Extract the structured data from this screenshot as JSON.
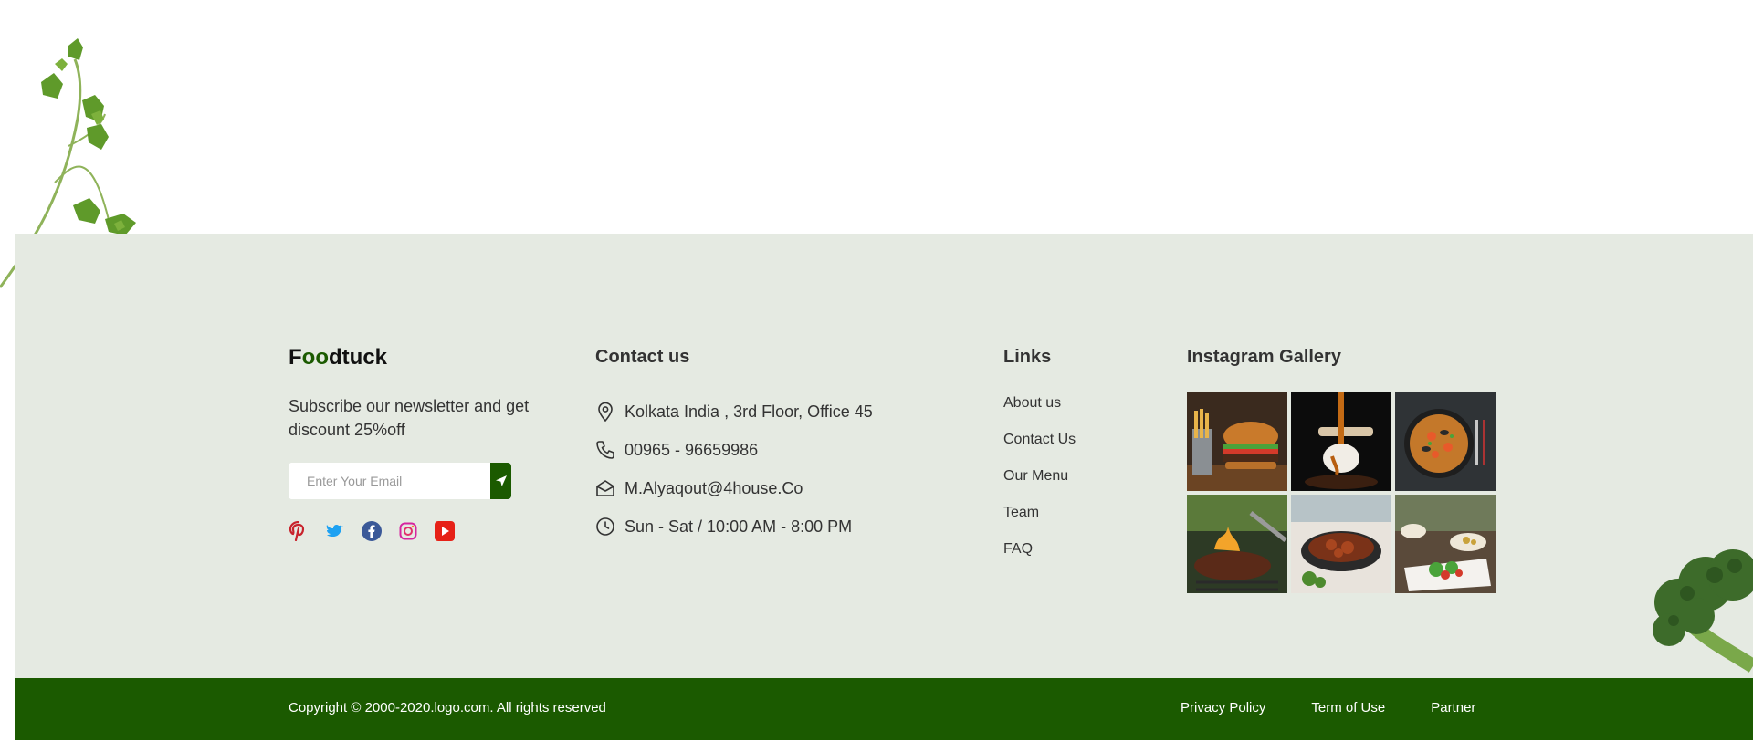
{
  "brand": {
    "logo_prefix": "F",
    "logo_oo": "oo",
    "logo_suffix": "dtuck"
  },
  "newsletter": {
    "text": "Subscribe our newsletter and get discount 25%off",
    "email_placeholder": "Enter Your Email"
  },
  "social": [
    "pinterest-icon",
    "twitter-icon",
    "facebook-icon",
    "instagram-icon",
    "youtube-icon"
  ],
  "contact": {
    "heading": "Contact us",
    "address": "Kolkata India , 3rd Floor, Office 45",
    "phone": "00965 - 96659986",
    "email": "M.Alyaqout@4house.Co",
    "hours": "Sun - Sat / 10:00 AM - 8:00 PM"
  },
  "links": {
    "heading": "Links",
    "items": [
      "About us",
      "Contact Us",
      "Our Menu",
      "Team",
      "FAQ"
    ]
  },
  "gallery": {
    "heading": "Instagram Gallery",
    "images": [
      "burger-with-fries",
      "dessert-with-caramel",
      "paella-pan",
      "grilled-steak",
      "braised-dish",
      "salad-table"
    ]
  },
  "bottom": {
    "copyright": "Copyright © 2000-2020.logo.com. All rights reserved",
    "legal": [
      "Privacy Policy",
      "Term of Use",
      "Partner"
    ]
  },
  "colors": {
    "brand_green": "#1b5a00",
    "footer_bg": "#e5eae2"
  }
}
